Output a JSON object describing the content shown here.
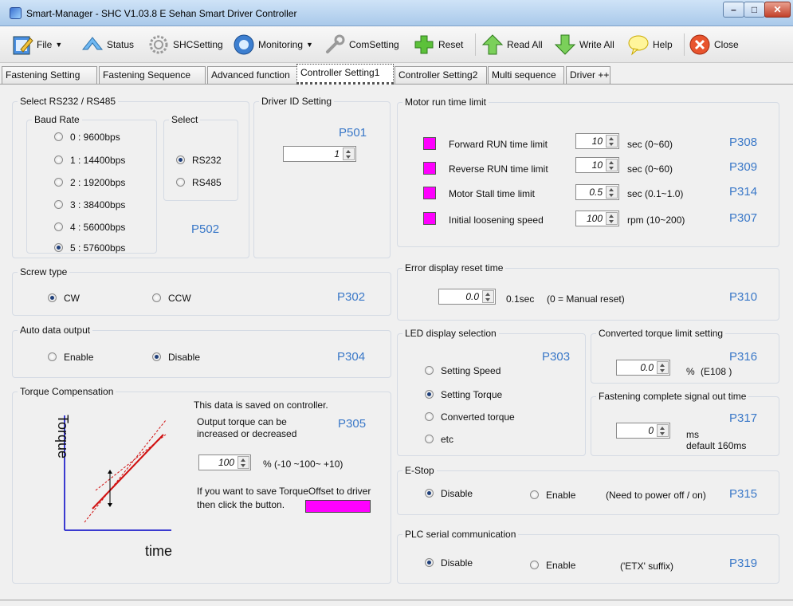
{
  "window": {
    "title": "Smart-Manager - SHC  V1.03.8 E  Sehan Smart Driver Controller"
  },
  "toolbar": {
    "file": "File",
    "status": "Status",
    "shc": "SHCSetting",
    "monitoring": "Monitoring",
    "comsetting": "ComSetting",
    "reset": "Reset",
    "readall": "Read All",
    "writeall": "Write All",
    "help": "Help",
    "close": "Close"
  },
  "tabs": [
    "Fastening Setting",
    "Fastening Sequence",
    "Advanced function",
    "Controller Setting1",
    "Controller Setting2",
    "Multi sequence",
    "Driver ++"
  ],
  "rs": {
    "title": "Select RS232 / RS485",
    "baud_title": "Baud Rate",
    "baud": [
      "0 : 9600bps",
      "1 : 14400bps",
      "2 : 19200bps",
      "3 : 38400bps",
      "4 : 56000bps",
      "5 : 57600bps"
    ],
    "select_title": "Select",
    "rs232": "RS232",
    "rs485": "RS485",
    "code": "P502"
  },
  "driver": {
    "title": "Driver ID Setting",
    "code": "P501",
    "value": "1"
  },
  "motor": {
    "title": "Motor run time limit",
    "rows": [
      {
        "label": "Forward RUN time limit",
        "value": "10",
        "unit": "sec (0~60)",
        "code": "P308"
      },
      {
        "label": "Reverse RUN time limit",
        "value": "10",
        "unit": "sec (0~60)",
        "code": "P309"
      },
      {
        "label": "Motor Stall time limit",
        "value": "0.5",
        "unit": "sec (0.1~1.0)",
        "code": "P314"
      },
      {
        "label": "Initial loosening speed",
        "value": "100",
        "unit": "rpm (10~200)",
        "code": "P307"
      }
    ]
  },
  "screw": {
    "title": "Screw type",
    "cw": "CW",
    "ccw": "CCW",
    "code": "P302"
  },
  "auto": {
    "title": "Auto data output",
    "enable": "Enable",
    "disable": "Disable",
    "code": "P304"
  },
  "torque": {
    "title": "Torque Compensation",
    "note": "This data is saved on controller.",
    "line1": "Output torque can be",
    "line2": "increased or decreased",
    "code": "P305",
    "value": "100",
    "range": "% (-10 ~100~ +10)",
    "save1": "If you want to save TorqueOffset to driver",
    "save2": "then click the button.",
    "ylabel": "Torque",
    "xlabel": "time"
  },
  "error": {
    "title": "Error display reset time",
    "value": "0.0",
    "unit": "0.1sec",
    "note": "(0 = Manual reset)",
    "code": "P310"
  },
  "led": {
    "title": "LED display selection",
    "code": "P303",
    "opts": [
      "Setting Speed",
      "Setting Torque",
      "Converted torque",
      "etc"
    ]
  },
  "conv": {
    "title": "Converted torque limit setting",
    "code": "P316",
    "value": "0.0",
    "unit": "%",
    "note": "(E108 )"
  },
  "fsig": {
    "title": "Fastening complete signal out time",
    "code": "P317",
    "value": "0",
    "unit": "ms",
    "def": "default 160ms"
  },
  "estop": {
    "title": "E-Stop",
    "disable": "Disable",
    "enable": "Enable",
    "note": "(Need to power off / on)",
    "code": "P315"
  },
  "plc": {
    "title": "PLC serial communication",
    "disable": "Disable",
    "enable": "Enable",
    "note": "('ETX'  suffix)",
    "code": "P319"
  }
}
